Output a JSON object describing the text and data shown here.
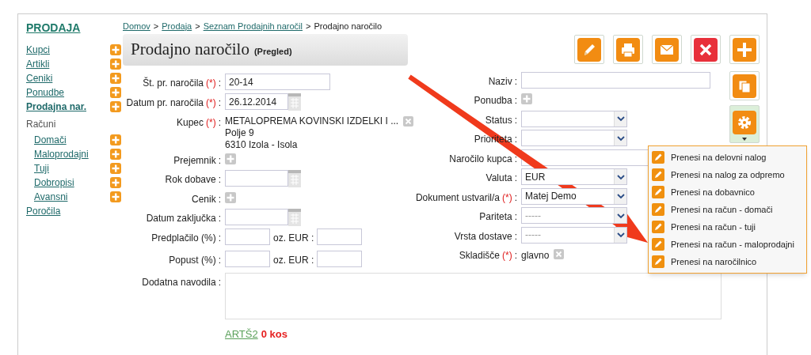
{
  "sidebar": {
    "title": "PRODAJA",
    "items": [
      {
        "label": "Kupci",
        "selected": false,
        "add": true
      },
      {
        "label": "Artikli",
        "selected": false,
        "add": true
      },
      {
        "label": "Ceniki",
        "selected": false,
        "add": true
      },
      {
        "label": "Ponudbe",
        "selected": false,
        "add": true
      },
      {
        "label": "Prodajna nar.",
        "selected": true,
        "add": true
      },
      {
        "label": "Računi",
        "kind": "header",
        "children": [
          {
            "label": "Domači",
            "selected": false,
            "add": true
          },
          {
            "label": "Maloprodajni",
            "selected": false,
            "add": true
          },
          {
            "label": "Tuji",
            "selected": false,
            "add": true
          },
          {
            "label": "Dobropisi",
            "selected": false,
            "add": true
          },
          {
            "label": "Avansni",
            "selected": false,
            "add": true
          }
        ]
      },
      {
        "label": "Poročila",
        "selected": false,
        "add": false
      }
    ]
  },
  "breadcrumb": {
    "links": [
      "Domov",
      "Prodaja",
      "Seznam Prodajnih naročil"
    ],
    "separator": ">",
    "current": "Prodajno naročilo"
  },
  "header": {
    "title": "Prodajno naročilo",
    "subtitle": "(Pregled)"
  },
  "toolbar": [
    {
      "kind": "edit"
    },
    {
      "kind": "print"
    },
    {
      "kind": "mail"
    },
    {
      "kind": "delete"
    },
    {
      "kind": "add"
    }
  ],
  "side_tools": [
    {
      "kind": "copy"
    },
    {
      "kind": "settings"
    }
  ],
  "left_fields": [
    {
      "kind": "text",
      "label": "Št. pr. naročila",
      "mark": "(*)",
      "sep": ":",
      "value": "20-14"
    },
    {
      "kind": "date",
      "label": "Datum pr. naročila",
      "mark": "(*)",
      "sep": ":",
      "value": "26.12.2014"
    },
    {
      "kind": "customer",
      "label": "Kupec",
      "mark": "(*)",
      "sep": ":",
      "lines": [
        "METALOPREMA KOVINSKI IZDELKI I ...",
        "Polje 9",
        "6310 Izola - Isola"
      ]
    },
    {
      "kind": "add",
      "label": "Prejemnik",
      "sep": ":"
    },
    {
      "kind": "date",
      "label": "Rok dobave",
      "sep": ":"
    },
    {
      "kind": "add",
      "label": "Cenik",
      "sep": ":"
    },
    {
      "kind": "date",
      "label": "Datum zaključka",
      "sep": ":"
    },
    {
      "kind": "pair",
      "label": "Predplačilo (%)",
      "sep": ":",
      "middle": "oz. EUR :"
    },
    {
      "kind": "pair",
      "label": "Popust (%)",
      "sep": ":",
      "middle": "oz. EUR :"
    },
    {
      "kind": "textarea",
      "label": "Dodatna navodila",
      "sep": ":"
    }
  ],
  "right_fields": [
    {
      "kind": "text",
      "label": "Naziv",
      "sep": ":"
    },
    {
      "kind": "add",
      "label": "Ponudba",
      "sep": ":"
    },
    {
      "kind": "select",
      "label": "Status",
      "sep": ":"
    },
    {
      "kind": "select",
      "label": "Prioriteta",
      "sep": ":"
    },
    {
      "kind": "text",
      "label": "Naročilo kupca",
      "sep": ":"
    },
    {
      "kind": "select",
      "label": "Valuta",
      "sep": ":",
      "value": "EUR"
    },
    {
      "kind": "select",
      "label": "Dokument ustvaril/a",
      "mark": "(*)",
      "sep": ":",
      "value": "Matej Demo"
    },
    {
      "kind": "select",
      "label": "Pariteta",
      "sep": ":",
      "placeholder": "-----"
    },
    {
      "kind": "select",
      "label": "Vrsta dostave",
      "sep": ":",
      "placeholder": "-----"
    },
    {
      "kind": "static",
      "label": "Skladišče",
      "mark": "(*)",
      "sep": ":",
      "value": "glavno"
    }
  ],
  "stock": {
    "code": "ARTŠ2",
    "amount": "0 kos"
  },
  "menu": [
    {
      "label": "Prenesi na delovni nalog"
    },
    {
      "label": "Prenesi na nalog za odpremo"
    },
    {
      "label": "Prenesi na dobavnico"
    },
    {
      "label": "Prenesi na račun - domači"
    },
    {
      "label": "Prenesi na račun - tuji"
    },
    {
      "label": "Prenesi na račun - maloprodajni"
    },
    {
      "label": "Prenesi na naročilnico"
    }
  ]
}
